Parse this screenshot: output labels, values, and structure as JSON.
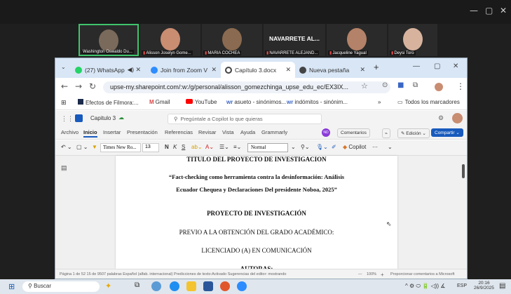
{
  "window_controls": {
    "minimize": "—",
    "restore": "▢",
    "close": "✕"
  },
  "participants": [
    {
      "name": "Washington Oswaldo Du...",
      "muted": false,
      "face": "#7a6a5c"
    },
    {
      "name": "Alisson Joselyn Gome...",
      "muted": true,
      "face": "#c98d72"
    },
    {
      "name": "MARIA COCHEA",
      "muted": true,
      "face": "#8a6a50"
    },
    {
      "name": "NAVARRETE ALEJAND...",
      "muted": true,
      "big_label": "NAVARRETE AL..."
    },
    {
      "name": "Jacqueline Yagual",
      "muted": true,
      "face": "#b48268"
    },
    {
      "name": "Deysi Toro",
      "muted": true,
      "face": "#d7b39e"
    }
  ],
  "tabs": [
    {
      "label": "(27) WhatsApp",
      "active": false,
      "color": "#25d366",
      "extra": "◀)"
    },
    {
      "label": "Join from Zoom V",
      "active": false,
      "color": "#2d8cff"
    },
    {
      "label": "Capítulo 3.docx",
      "active": true,
      "color": "#444"
    },
    {
      "label": "Nueva pestaña",
      "active": false,
      "color": "#444"
    }
  ],
  "url": "upse-my.sharepoint.com/:w:/g/personal/alisson_gomezchinga_upse_edu_ec/EX3IX...",
  "bookmarks": [
    "Efectos de Filmora:...",
    "Gmail",
    "YouTube",
    "asueto - sinónimos...",
    "indómitos - sinónim...",
    "Todos los marcadores"
  ],
  "word": {
    "doc_name": "Capitulo 3",
    "search_placeholder": "Pregúntale a Copilot lo que quieras"
  },
  "ribbon_tabs": [
    "Archivo",
    "Inicio",
    "Insertar",
    "Presentación",
    "Referencias",
    "Revisar",
    "Vista",
    "Ayuda",
    "Grammarly"
  ],
  "ribbon_right": {
    "comments": "Comentarios",
    "editing": "Edición",
    "share": "Compartir",
    "avatar": "ND"
  },
  "toolbar": {
    "font": "Times New Ro...",
    "size": "13",
    "style": "Normal",
    "copilot": "Copilot"
  },
  "document_lines": [
    "TITULO DEL PROYECTO DE INVESTIGACION",
    "“Fact-checking como herramienta contra la desinformación: Análisis",
    "Ecuador Chequea y Declaraciones Del presidente Noboa, 2025”",
    "PROYECTO DE INVESTIGACIÓN",
    "PREVIO A LA OBTENCIÓN DEL GRADO ACADÉMICO:",
    "LICENCIADO (A) EN COMUNICACIÓN",
    "AUTORAS:"
  ],
  "status": {
    "left": "Página 1 de 52  15 de 9507 palabras  Español (alfab. internacional)  Predicciones de texto:Activado  Sugerencias del editor: mostrando",
    "zoom": "100%",
    "right": "Proporcionar comentarios a Microsoft"
  },
  "taskbar": {
    "search": "Buscar",
    "time": "20:16",
    "date": "26/9/2025",
    "lang": "ESP"
  }
}
